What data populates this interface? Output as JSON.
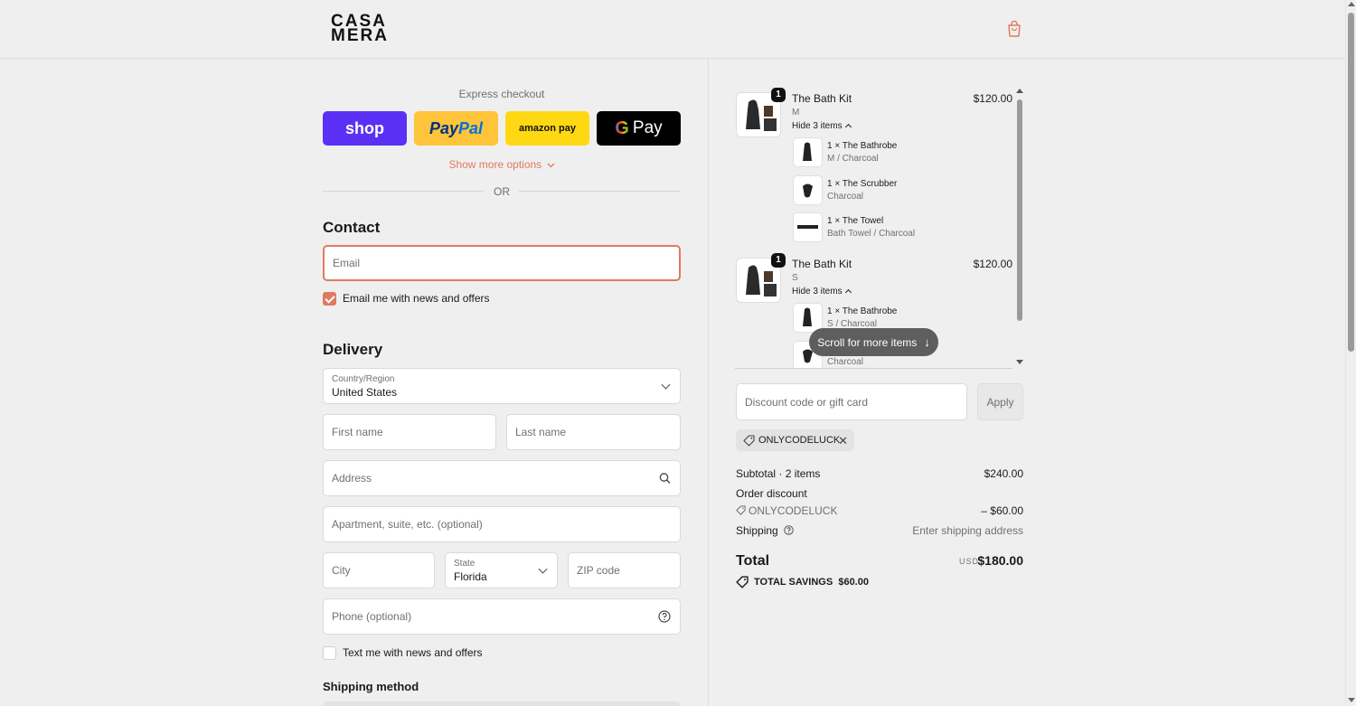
{
  "brand": {
    "logo_line1": "CASA",
    "logo_line2": "MERA"
  },
  "express": {
    "title": "Express checkout",
    "shop_label": "shop",
    "paypal_label_a": "Pay",
    "paypal_label_b": "Pal",
    "amazon_label": "amazon pay",
    "gpay_label": "Pay",
    "show_more": "Show more options",
    "or": "OR"
  },
  "contact": {
    "title": "Contact",
    "email_placeholder": "Email",
    "news_label": "Email me with news and offers",
    "news_checked": true
  },
  "delivery": {
    "title": "Delivery",
    "country_label": "Country/Region",
    "country_value": "United States",
    "first_name": "First name",
    "last_name": "Last name",
    "address": "Address",
    "apartment": "Apartment, suite, etc. (optional)",
    "city": "City",
    "state_label": "State",
    "state_value": "Florida",
    "zip": "ZIP code",
    "phone": "Phone (optional)",
    "text_label": "Text me with news and offers",
    "text_checked": false
  },
  "shipping_method": {
    "title": "Shipping method"
  },
  "cart": {
    "items": [
      {
        "qty": "1",
        "name": "The Bath Kit",
        "variant": "M",
        "price": "$120.00",
        "toggle": "Hide 3 items",
        "subitems": [
          {
            "name": "1 × The Bathrobe",
            "variant": "M / Charcoal"
          },
          {
            "name": "1 × The Scrubber",
            "variant": "Charcoal"
          },
          {
            "name": "1 × The Towel",
            "variant": "Bath Towel / Charcoal"
          }
        ]
      },
      {
        "qty": "1",
        "name": "The Bath Kit",
        "variant": "S",
        "price": "$120.00",
        "toggle": "Hide 3 items",
        "subitems": [
          {
            "name": "1 × The Bathrobe",
            "variant": "S / Charcoal"
          },
          {
            "name": "",
            "variant": "Charcoal"
          }
        ]
      }
    ],
    "scroll_hint": "Scroll for more items"
  },
  "discount": {
    "placeholder": "Discount code or gift card",
    "apply": "Apply",
    "applied_code": "ONLYCODELUCK"
  },
  "summary": {
    "subtotal_label": "Subtotal · 2 items",
    "subtotal_value": "$240.00",
    "order_discount_label": "Order discount",
    "discount_code": "ONLYCODELUCK",
    "discount_value": "– $60.00",
    "shipping_label": "Shipping",
    "shipping_value": "Enter shipping address",
    "total_label": "Total",
    "currency": "USD",
    "total_value": "$180.00",
    "savings_label": "TOTAL SAVINGS",
    "savings_value": "$60.00"
  },
  "colors": {
    "accent": "#e07a5f",
    "shop": "#5a31f4",
    "paypal": "#ffc439",
    "amazon": "#ffd814",
    "gpay": "#000000"
  }
}
